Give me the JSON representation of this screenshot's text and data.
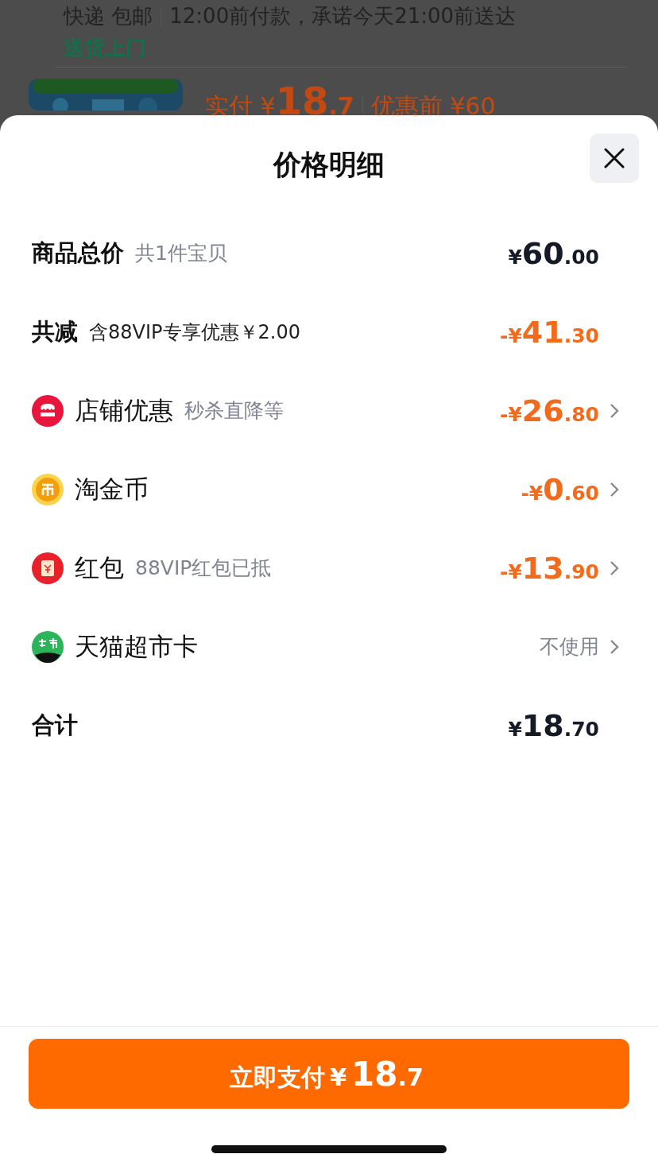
{
  "background_page": {
    "delivery": {
      "tags": "快递 包邮",
      "promise": "12:00前付款，承诺今天21:00前送达",
      "highlight": "送货上门"
    },
    "price_line": {
      "label": "实付 ¥",
      "price_int": "18",
      "price_dec": ".7",
      "original": "优惠前 ¥60"
    }
  },
  "sheet": {
    "title": "价格明细",
    "rows": [
      {
        "kind": "summary",
        "label": "商品总价",
        "note": "共1件宝贝",
        "note_muted": true,
        "amount": {
          "negative": false,
          "sign": "¥",
          "int": "60",
          "dec": ".00"
        },
        "chevron": false
      },
      {
        "kind": "summary",
        "label": "共减",
        "note": "含88VIP专享优惠￥2.00",
        "note_muted": false,
        "amount": {
          "negative": true,
          "sign": "-¥",
          "int": "41",
          "dec": ".30"
        },
        "chevron": false
      },
      {
        "kind": "shop",
        "label": "店铺优惠",
        "note": "秒杀直降等",
        "note_muted": true,
        "amount": {
          "negative": true,
          "sign": "-¥",
          "int": "26",
          "dec": ".80"
        },
        "chevron": true
      },
      {
        "kind": "coin",
        "label": "淘金币",
        "amount": {
          "negative": true,
          "sign": "-¥",
          "int": "0",
          "dec": ".60"
        },
        "chevron": true
      },
      {
        "kind": "redpacket",
        "label": "红包",
        "note": "88VIP红包已抵",
        "note_muted": true,
        "amount": {
          "negative": true,
          "sign": "-¥",
          "int": "13",
          "dec": ".90"
        },
        "chevron": true
      },
      {
        "kind": "card",
        "label": "天猫超市卡",
        "value": "不使用",
        "chevron": true
      },
      {
        "kind": "summary",
        "label": "合计",
        "amount": {
          "negative": false,
          "sign": "¥",
          "int": "18",
          "dec": ".70"
        },
        "chevron": false
      }
    ],
    "pay_button": {
      "label": "立即支付",
      "sign": "¥",
      "int": "18",
      "dec": ".7"
    }
  }
}
